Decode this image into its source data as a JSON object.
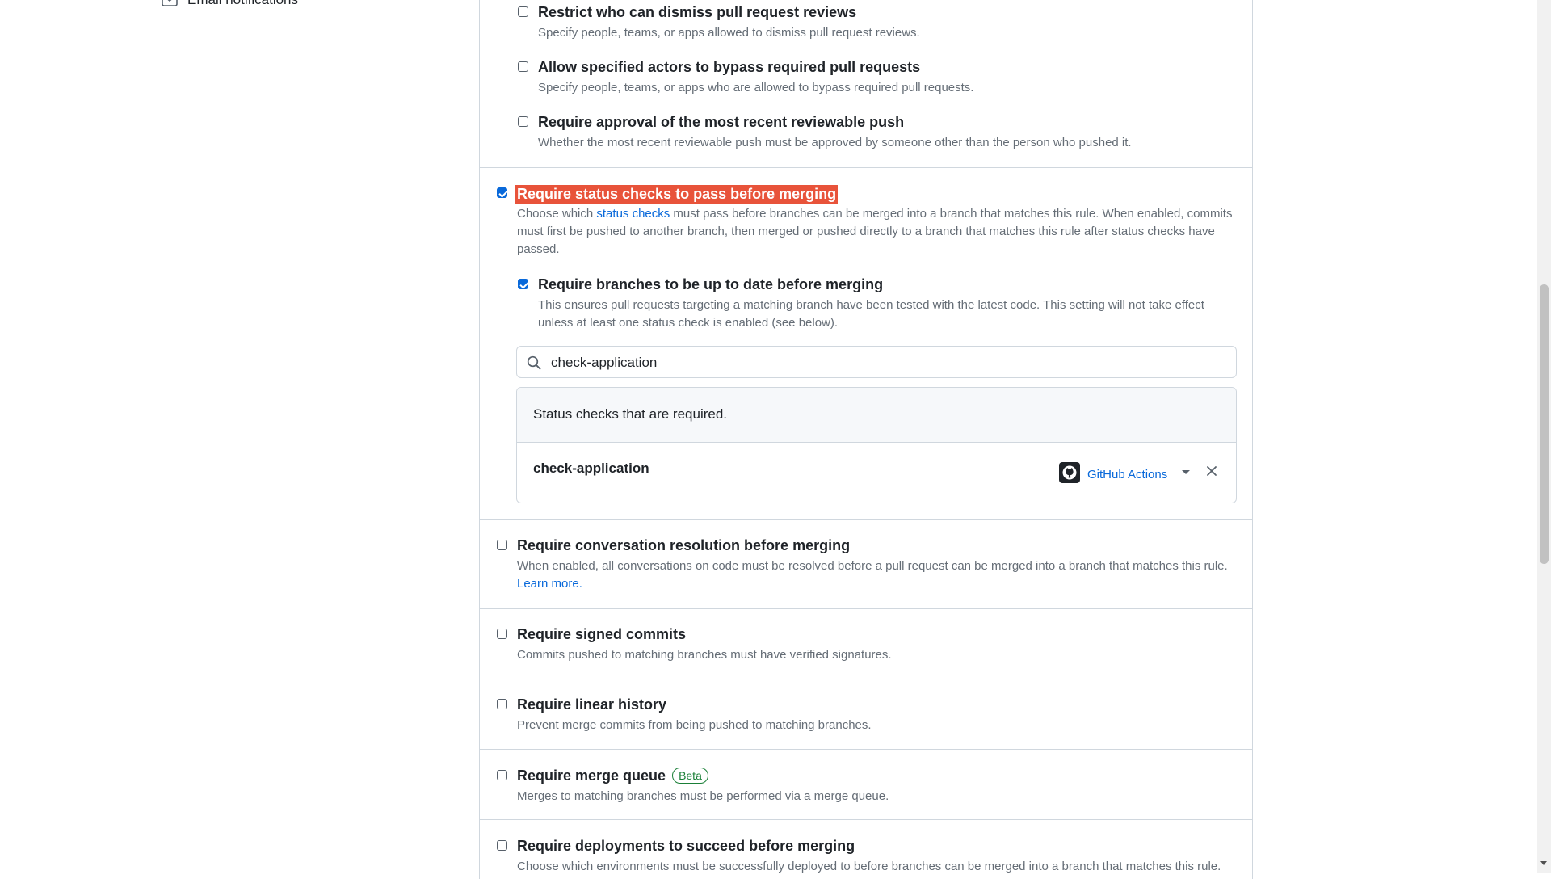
{
  "sidebar": {
    "email_notifications": "Email notifications"
  },
  "rules": [
    {
      "id": "dismiss",
      "title": "Restrict who can dismiss pull request reviews",
      "desc": "Specify people, teams, or apps allowed to dismiss pull request reviews.",
      "checked": false
    },
    {
      "id": "bypass",
      "title": "Allow specified actors to bypass required pull requests",
      "desc": "Specify people, teams, or apps who are allowed to bypass required pull requests.",
      "checked": false
    },
    {
      "id": "approval",
      "title": "Require approval of the most recent reviewable push",
      "desc": "Whether the most recent reviewable push must be approved by someone other than the person who pushed it.",
      "checked": false
    },
    {
      "id": "status_checks",
      "title": "Require status checks to pass before merging",
      "desc_before": "Choose which ",
      "desc_link": "status checks",
      "desc_after": " must pass before branches can be merged into a branch that matches this rule. When enabled, commits must first be pushed to another branch, then merged or pushed directly to a branch that matches this rule after status checks have passed.",
      "checked": true
    },
    {
      "id": "up_to_date",
      "title": "Require branches to be up to date before merging",
      "desc": "This ensures pull requests targeting a matching branch have been tested with the latest code. This setting will not take effect unless at least one status check is enabled (see below).",
      "checked": true
    },
    {
      "id": "conversation",
      "title": "Require conversation resolution before merging",
      "desc": "When enabled, all conversations on code must be resolved before a pull request can be merged into a branch that matches this rule.",
      "desc_link": "Learn more.",
      "checked": false
    },
    {
      "id": "signed",
      "title": "Require signed commits",
      "desc": "Commits pushed to matching branches must have verified signatures.",
      "checked": false
    },
    {
      "id": "linear",
      "title": "Require linear history",
      "desc": "Prevent merge commits from being pushed to matching branches.",
      "checked": false
    },
    {
      "id": "merge_queue",
      "title": "Require merge queue",
      "badge": "Beta",
      "desc": "Merges to matching branches must be performed via a merge queue.",
      "checked": false
    },
    {
      "id": "deployments",
      "title": "Require deployments to succeed before merging",
      "desc": "Choose which environments must be successfully deployed to before branches can be merged into a branch that matches this rule.",
      "checked": false
    }
  ],
  "status_checks": {
    "search_value": "check-application",
    "header": "Status checks that are required.",
    "items": [
      {
        "name": "check-application",
        "app": "GitHub Actions"
      }
    ]
  },
  "colors": {
    "highlight": "#e8533a",
    "link": "#0969da",
    "badge": "#1a7f37"
  }
}
